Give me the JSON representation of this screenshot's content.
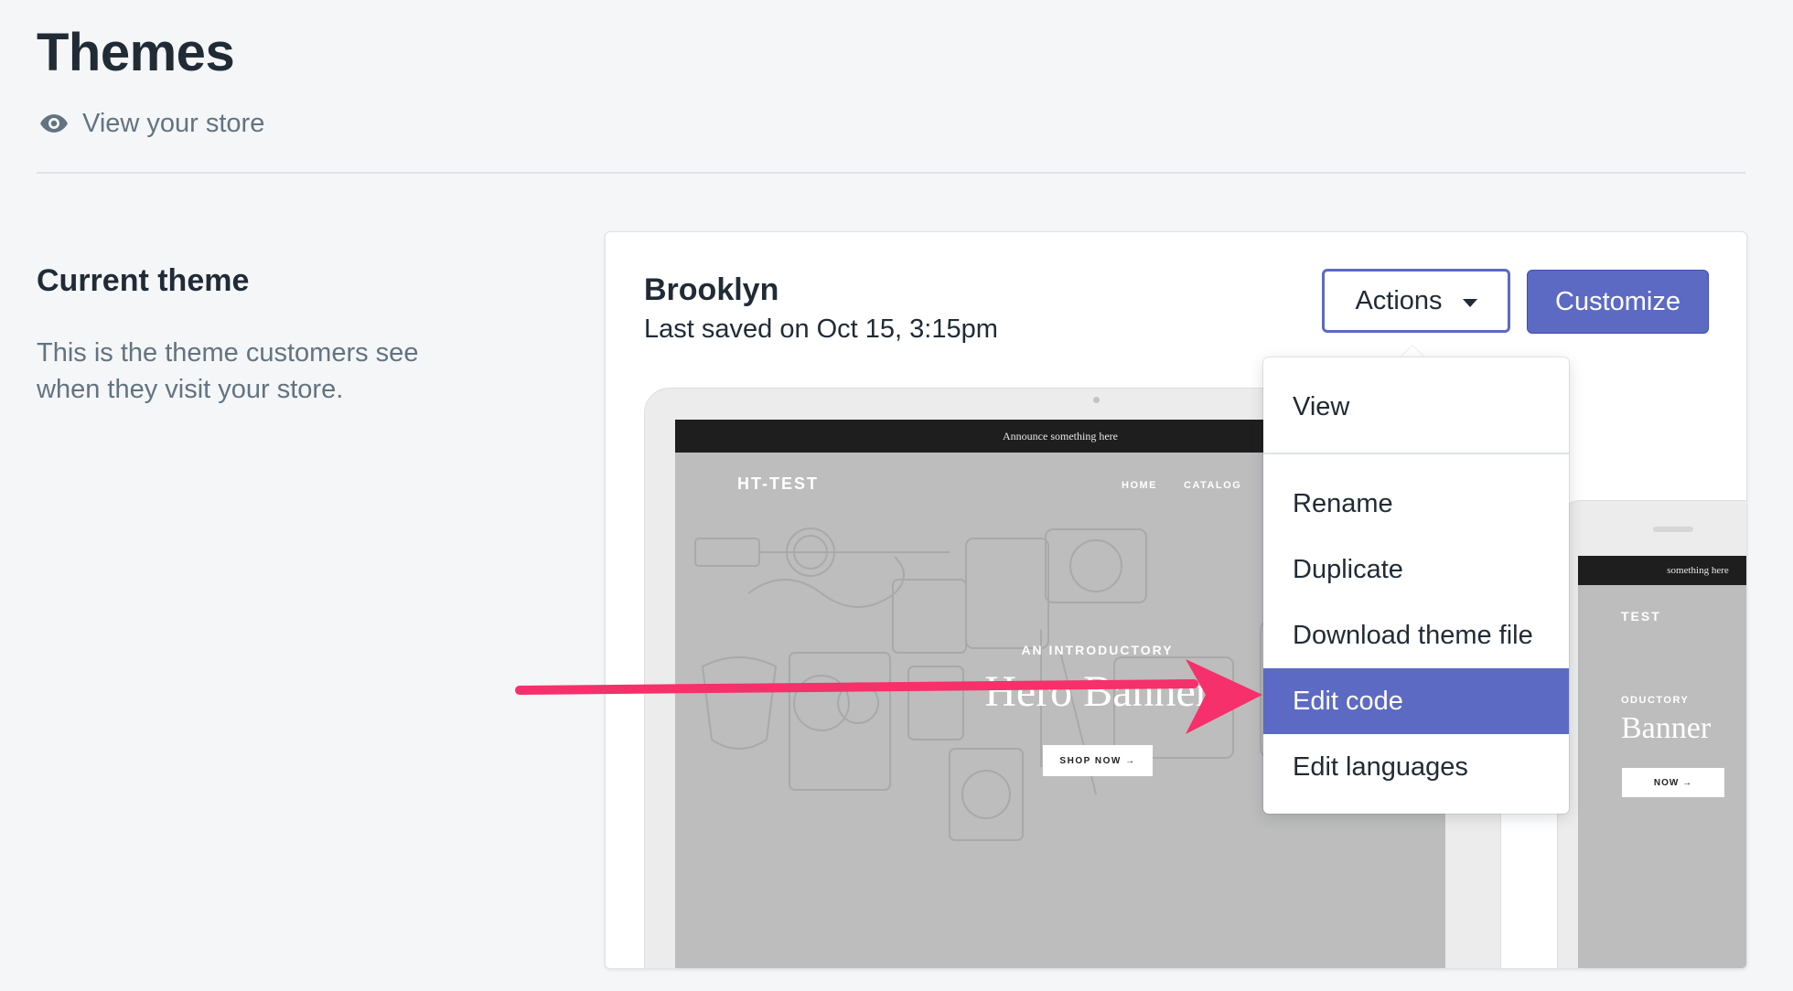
{
  "header": {
    "title": "Themes",
    "view_store_label": "View your store"
  },
  "section": {
    "title": "Current theme",
    "description": "This is the theme customers see when they visit your store."
  },
  "theme": {
    "name": "Brooklyn",
    "last_saved": "Last saved on Oct 15, 3:15pm",
    "actions_label": "Actions",
    "customize_label": "Customize"
  },
  "preview": {
    "announcement": "Announce something here",
    "store_name": "HT-TEST",
    "nav": [
      "HOME",
      "CATALOG"
    ],
    "hero_pre": "AN INTRODUCTORY",
    "hero_title": "Hero Banner",
    "hero_button": "SHOP NOW →"
  },
  "phone_preview": {
    "announcement": "something here",
    "store_name": "TEST",
    "hero_pre": "ODUCTORY",
    "hero_title": "Banner",
    "hero_button": "NOW →"
  },
  "actions_menu": {
    "items": [
      {
        "label": "View",
        "highlighted": false
      },
      {
        "label": "Rename",
        "highlighted": false
      },
      {
        "label": "Duplicate",
        "highlighted": false
      },
      {
        "label": "Download theme file",
        "highlighted": false
      },
      {
        "label": "Edit code",
        "highlighted": true
      },
      {
        "label": "Edit languages",
        "highlighted": false
      }
    ]
  },
  "colors": {
    "primary": "#5c6ac4",
    "annotation_arrow": "#f5306b",
    "background": "#f4f6f8"
  }
}
